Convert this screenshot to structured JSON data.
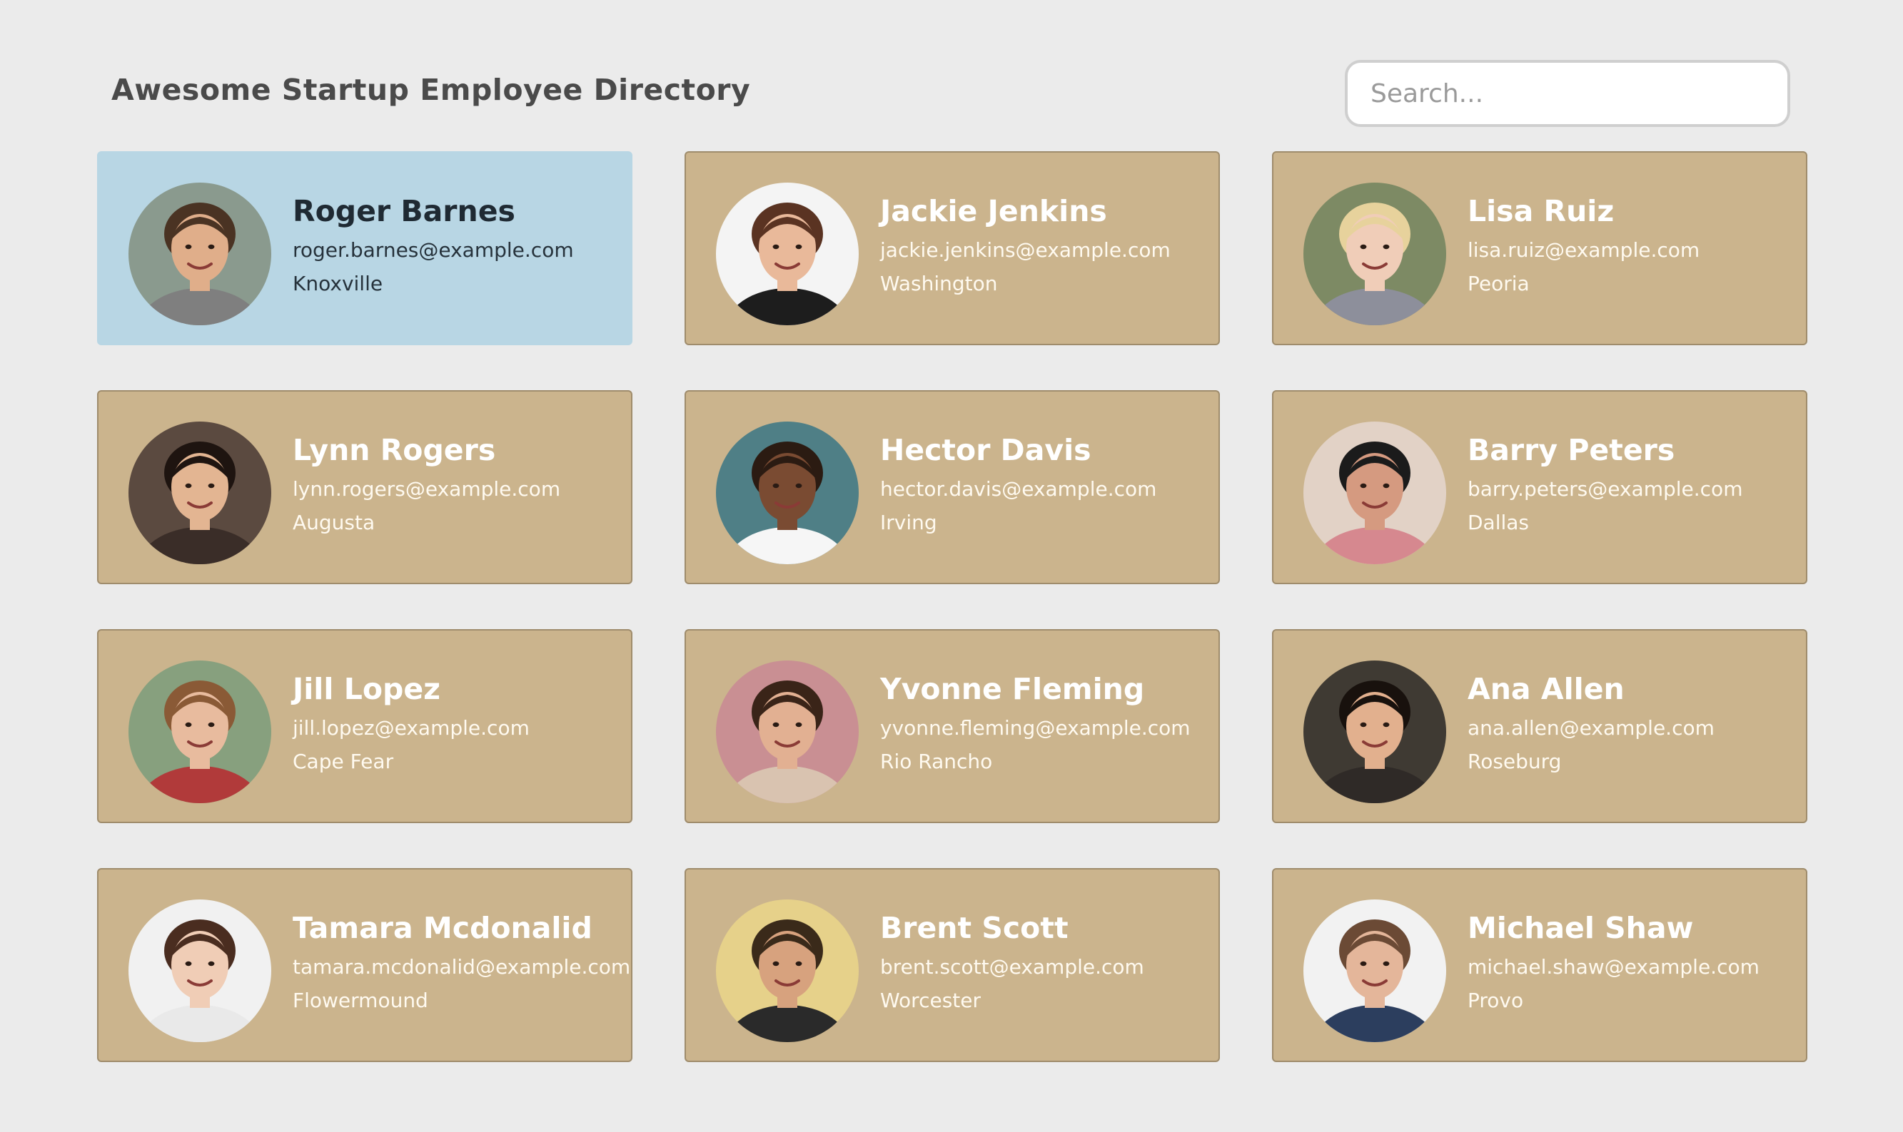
{
  "header": {
    "title": "Awesome Startup Employee Directory",
    "search_placeholder": "Search..."
  },
  "colors": {
    "page_background": "#ebebeb",
    "card_background": "#cbb48d",
    "card_selected_background": "#b8d6e4",
    "card_text": "#ffffff",
    "selected_text": "#1f2a33"
  },
  "employees": [
    {
      "name": "Roger Barnes",
      "email": "roger.barnes@example.com",
      "city": "Knoxville",
      "selected": true,
      "avatar": {
        "bg": "#8a9a8e",
        "skin": "#e0ae8a",
        "hair": "#4a3323",
        "shirt": "#7f7f7f"
      }
    },
    {
      "name": "Jackie Jenkins",
      "email": "jackie.jenkins@example.com",
      "city": "Washington",
      "selected": false,
      "avatar": {
        "bg": "#f4f4f4",
        "skin": "#e9b99a",
        "hair": "#5a3322",
        "shirt": "#1d1d1d"
      }
    },
    {
      "name": "Lisa Ruiz",
      "email": "lisa.ruiz@example.com",
      "city": "Peoria",
      "selected": false,
      "avatar": {
        "bg": "#7d8a64",
        "skin": "#f0cdb8",
        "hair": "#e7d29c",
        "shirt": "#8d8f9b"
      }
    },
    {
      "name": "Lynn Rogers",
      "email": "lynn.rogers@example.com",
      "city": "Augusta",
      "selected": false,
      "avatar": {
        "bg": "#5b4a40",
        "skin": "#e3b592",
        "hair": "#1e1410",
        "shirt": "#3a2d28"
      }
    },
    {
      "name": "Hector Davis",
      "email": "hector.davis@example.com",
      "city": "Irving",
      "selected": false,
      "avatar": {
        "bg": "#4f7f86",
        "skin": "#7a4b32",
        "hair": "#2b1b12",
        "shirt": "#f6f6f6"
      }
    },
    {
      "name": "Barry Peters",
      "email": "barry.peters@example.com",
      "city": "Dallas",
      "selected": false,
      "avatar": {
        "bg": "#e2d2c6",
        "skin": "#d59a80",
        "hair": "#1b1b1b",
        "shirt": "#d6888f"
      }
    },
    {
      "name": "Jill Lopez",
      "email": "jill.lopez@example.com",
      "city": "Cape Fear",
      "selected": false,
      "avatar": {
        "bg": "#87a07e",
        "skin": "#e8bb9e",
        "hair": "#8a5a36",
        "shirt": "#b13a3a"
      }
    },
    {
      "name": "Yvonne Fleming",
      "email": "yvonne.fleming@example.com",
      "city": "Rio Rancho",
      "selected": false,
      "avatar": {
        "bg": "#c98f93",
        "skin": "#e2b092",
        "hair": "#3a2418",
        "shirt": "#d9c3b0"
      }
    },
    {
      "name": "Ana Allen",
      "email": "ana.allen@example.com",
      "city": "Roseburg",
      "selected": false,
      "avatar": {
        "bg": "#3f3a33",
        "skin": "#e2b08e",
        "hair": "#18110d",
        "shirt": "#2f2a27"
      }
    },
    {
      "name": "Tamara Mcdonalid",
      "email": "tamara.mcdonalid@example.com",
      "city": "Flowermound",
      "selected": false,
      "avatar": {
        "bg": "#f1f1f1",
        "skin": "#f0cdb6",
        "hair": "#4a2d20",
        "shirt": "#e9e9e9"
      }
    },
    {
      "name": "Brent Scott",
      "email": "brent.scott@example.com",
      "city": "Worcester",
      "selected": false,
      "avatar": {
        "bg": "#e6d18a",
        "skin": "#d7a27e",
        "hair": "#3a2a1a",
        "shirt": "#2a2a2a"
      }
    },
    {
      "name": "Michael Shaw",
      "email": "michael.shaw@example.com",
      "city": "Provo",
      "selected": false,
      "avatar": {
        "bg": "#f2f2f2",
        "skin": "#e4b69a",
        "hair": "#6b4a35",
        "shirt": "#2c3e5e"
      }
    }
  ]
}
